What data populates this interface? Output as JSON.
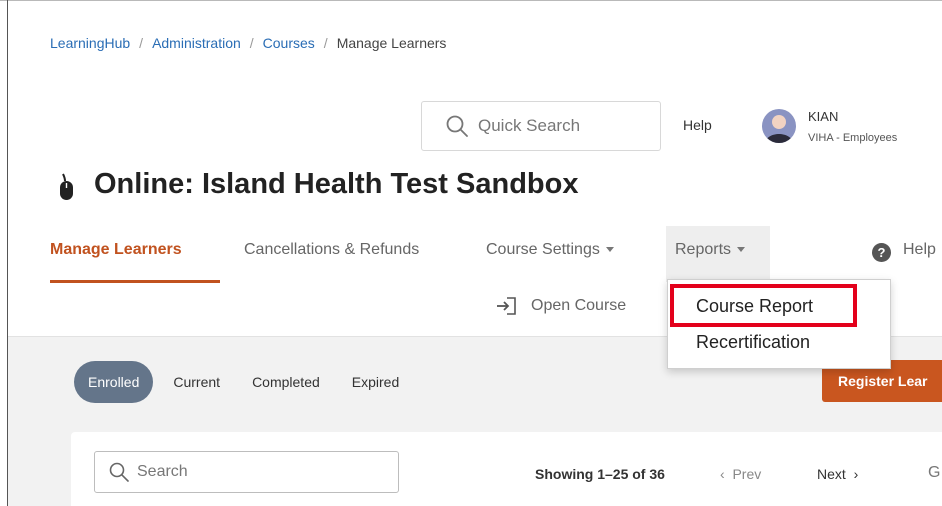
{
  "breadcrumb": {
    "items": [
      "LearningHub",
      "Administration",
      "Courses"
    ],
    "separator": "/",
    "current": "Manage Learners"
  },
  "header": {
    "search_placeholder": "Quick Search",
    "help_label": "Help",
    "user": {
      "name": "KIAN",
      "org": "VIHA - Employees"
    }
  },
  "page": {
    "title": "Online: Island Health Test Sandbox"
  },
  "tabs": [
    {
      "label": "Manage Learners",
      "active": true
    },
    {
      "label": "Cancellations & Refunds"
    },
    {
      "label": "Course Settings"
    },
    {
      "label": "Reports"
    },
    {
      "label": "Help"
    }
  ],
  "open_course_label": "Open Course",
  "reports_menu": {
    "items": [
      "Course Report",
      "Recertification"
    ],
    "highlighted": "Course Report"
  },
  "filters": [
    {
      "label": "Enrolled",
      "active": true
    },
    {
      "label": "Current"
    },
    {
      "label": "Completed"
    },
    {
      "label": "Expired"
    }
  ],
  "register_button_label": "Register Lear",
  "learner_search_placeholder": "Search",
  "pagination": {
    "showing": "Showing 1–25 of 36",
    "prev": "Prev",
    "next": "Next"
  },
  "colors": {
    "accent": "#c1521f",
    "link": "#2a6db5",
    "pill_active": "#64758a",
    "highlight": "#e3001b"
  },
  "icons": [
    "search-icon",
    "avatar-icon",
    "mouse-icon",
    "help-circle-icon",
    "open-course-icon",
    "chevron-left-icon",
    "chevron-right-icon"
  ]
}
